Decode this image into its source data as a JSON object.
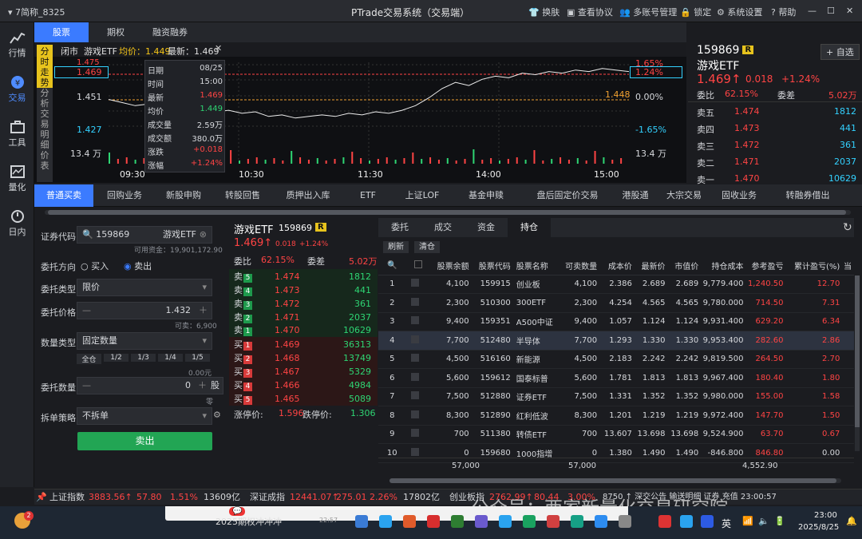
{
  "titlebar": {
    "account": "7简称_8325",
    "title": "PTrade交易系统（交易端）",
    "buttons": [
      "换肤",
      "查看协议",
      "多账号管理",
      "锁定",
      "系统设置",
      "帮助"
    ]
  },
  "leftnav": [
    {
      "label": "行情",
      "icon": "chart-line-icon"
    },
    {
      "label": "交易",
      "icon": "trade-icon",
      "active": true
    },
    {
      "label": "工具",
      "icon": "toolbox-icon"
    },
    {
      "label": "量化",
      "icon": "quant-icon"
    },
    {
      "label": "日内",
      "icon": "intraday-icon"
    }
  ],
  "top_tabs": [
    "股票",
    "期权",
    "融资融券"
  ],
  "chart": {
    "info": {
      "status": "闭市",
      "name": "游戏ETF",
      "avg_label": "均价：1.449",
      "last_label": "最新：1.469"
    },
    "side_labels": [
      "分",
      "时",
      "走",
      "势",
      "分",
      "析",
      "交",
      "易",
      "明",
      "细",
      "价",
      "表"
    ],
    "left_axis": [
      "1.475",
      "1.469",
      "1.451",
      "1.427",
      "13.4 万"
    ],
    "right_axis": [
      "1.65%",
      "1.24%",
      "0.00%",
      "-1.65%",
      "13.4 万"
    ],
    "avg_tag": "1.448",
    "times": [
      "09:30",
      "10:30",
      "11:30",
      "14:00",
      "15:00"
    ],
    "price_series": [
      1.451,
      1.449,
      1.447,
      1.448,
      1.446,
      1.447,
      1.445,
      1.446,
      1.443,
      1.444,
      1.442,
      1.443,
      1.44,
      1.441,
      1.439,
      1.44,
      1.441,
      1.44,
      1.442,
      1.441,
      1.443,
      1.442,
      1.444,
      1.447,
      1.452,
      1.458,
      1.462,
      1.46,
      1.464,
      1.466,
      1.465,
      1.468,
      1.467,
      1.469,
      1.468,
      1.47,
      1.469,
      1.471,
      1.47,
      1.469
    ]
  },
  "tooltip": {
    "rows": [
      [
        "日期",
        "08/25"
      ],
      [
        "时间",
        "15:00"
      ],
      [
        "最新",
        "1.469"
      ],
      [
        "均价",
        "1.449"
      ],
      [
        "成交量",
        "2.59万"
      ],
      [
        "成交额",
        "380.0万"
      ],
      [
        "涨跌",
        "+0.018"
      ],
      [
        "涨幅",
        "+1.24%"
      ]
    ]
  },
  "quote": {
    "code": "159869",
    "tag": "R",
    "name": "游戏ETF",
    "price": "1.469",
    "change": "0.018",
    "pct": "+1.24%",
    "add_btn": "+ 自选",
    "wb_label": "委比",
    "wb_val": "62.15%",
    "wc_label": "委差",
    "wc_val": "5.02万",
    "asks": [
      [
        "卖五",
        "1.474",
        "1812"
      ],
      [
        "卖四",
        "1.473",
        "441"
      ],
      [
        "卖三",
        "1.472",
        "361"
      ],
      [
        "卖二",
        "1.471",
        "2037"
      ],
      [
        "卖一",
        "1.470",
        "10629"
      ]
    ]
  },
  "func_tabs": [
    "普通买卖",
    "回购业务",
    "新股申购",
    "转股回售",
    "质押出入库",
    "ETF",
    "上证LOF",
    "基金申赎",
    "盘后固定价交易",
    "港股通",
    "大宗交易",
    "固收业务",
    "转融券借出"
  ],
  "order": {
    "code_label": "证券代码",
    "code": "159869",
    "name": "游戏ETF",
    "funds": "可用资金：19,901,172.90",
    "dir_label": "委托方向",
    "buy": "买入",
    "sell": "卖出",
    "type_label": "委托类型",
    "type": "限价",
    "price_label": "委托价格",
    "price": "1.432",
    "avail": "可卖：6,900",
    "qtype_label": "数量类型",
    "qtype": "固定数量",
    "fracs": [
      "全仓",
      "1/2",
      "1/3",
      "1/4",
      "1/5"
    ],
    "amt": "0.00元",
    "qty_label": "委托数量",
    "qty": "0",
    "unit": "股",
    "unit2": "零",
    "split_label": "拆单策略",
    "split": "不拆单",
    "submit": "卖出"
  },
  "book": {
    "name": "游戏ETF",
    "code": "159869",
    "tag": "R",
    "price": "1.469",
    "change": "0.018",
    "pct": "+1.24%",
    "wb_label": "委比",
    "wb_val": "62.15%",
    "wc_label": "委差",
    "wc_val": "5.02万",
    "asks": [
      [
        "卖",
        "5",
        "1.474",
        "1812"
      ],
      [
        "卖",
        "4",
        "1.473",
        "441"
      ],
      [
        "卖",
        "3",
        "1.472",
        "361"
      ],
      [
        "卖",
        "2",
        "1.471",
        "2037"
      ],
      [
        "卖",
        "1",
        "1.470",
        "10629"
      ]
    ],
    "bids": [
      [
        "买",
        "1",
        "1.469",
        "36313"
      ],
      [
        "买",
        "2",
        "1.468",
        "13749"
      ],
      [
        "买",
        "3",
        "1.467",
        "5329"
      ],
      [
        "买",
        "4",
        "1.466",
        "4984"
      ],
      [
        "买",
        "5",
        "1.465",
        "5089"
      ]
    ],
    "limit_up_label": "涨停价:",
    "limit_up": "1.596",
    "limit_down_label": "跌停价:",
    "limit_down": "1.306"
  },
  "holdings": {
    "tabs": [
      "委托",
      "成交",
      "资金",
      "持仓"
    ],
    "refresh": "刷新",
    "clear": "清仓",
    "headers": [
      "股票余额",
      "股票代码",
      "股票名称",
      "可卖数量",
      "成本价",
      "最新价",
      "市值价",
      "持仓成本",
      "参考盈亏",
      "累计盈亏(%)",
      "当"
    ],
    "rows": [
      [
        "1",
        "4,100",
        "159915",
        "创业板",
        "4,100",
        "2.386",
        "2.689",
        "2.689",
        "9,779.400",
        "1,240.50",
        "12.70"
      ],
      [
        "2",
        "2,300",
        "510300",
        "300ETF",
        "2,300",
        "4.254",
        "4.565",
        "4.565",
        "9,780.000",
        "714.50",
        "7.31"
      ],
      [
        "3",
        "9,400",
        "159351",
        "A500中证",
        "9,400",
        "1.057",
        "1.124",
        "1.124",
        "9,931.400",
        "629.20",
        "6.34"
      ],
      [
        "4",
        "7,700",
        "512480",
        "半导体",
        "7,700",
        "1.293",
        "1.330",
        "1.330",
        "9,953.400",
        "282.60",
        "2.86"
      ],
      [
        "5",
        "4,500",
        "516160",
        "新能源",
        "4,500",
        "2.183",
        "2.242",
        "2.242",
        "9,819.500",
        "264.50",
        "2.70"
      ],
      [
        "6",
        "5,600",
        "159612",
        "国泰标普",
        "5,600",
        "1.781",
        "1.813",
        "1.813",
        "9,967.400",
        "180.40",
        "1.80"
      ],
      [
        "7",
        "7,500",
        "512880",
        "证券ETF",
        "7,500",
        "1.331",
        "1.352",
        "1.352",
        "9,980.000",
        "155.00",
        "1.58"
      ],
      [
        "8",
        "8,300",
        "512890",
        "红利低波",
        "8,300",
        "1.201",
        "1.219",
        "1.219",
        "9,972.400",
        "147.70",
        "1.50"
      ],
      [
        "9",
        "700",
        "511380",
        "转债ETF",
        "700",
        "13.607",
        "13.698",
        "13.698",
        "9,524.900",
        "63.70",
        "0.67"
      ],
      [
        "10",
        "0",
        "159680",
        "1000指增",
        "0",
        "1.380",
        "1.490",
        "1.490",
        "-846.800",
        "846.80",
        "0.00"
      ]
    ],
    "totals": [
      "57,000",
      "57,000",
      "4,552.90"
    ]
  },
  "indexbar": [
    [
      "上证指数",
      "3883.56",
      "57.80",
      "1.51%",
      "13609亿"
    ],
    [
      "深证成指",
      "12441.07",
      "275.01",
      "2.26%",
      "17802亿"
    ],
    [
      "创业板指",
      "2762.99",
      "80.44",
      "3.00%",
      ""
    ]
  ],
  "indexbar_tail": "8750 ↑  深交公告  输送明细 证券 充值 23:00:57",
  "watermark": "公众号：西家新量化交易研究院",
  "taskbar": {
    "notice": "2025期权冲冲冲",
    "notice_time": "22:57",
    "badge": "2",
    "time": "23:00",
    "date": "2025/8/25",
    "ime": "英"
  }
}
